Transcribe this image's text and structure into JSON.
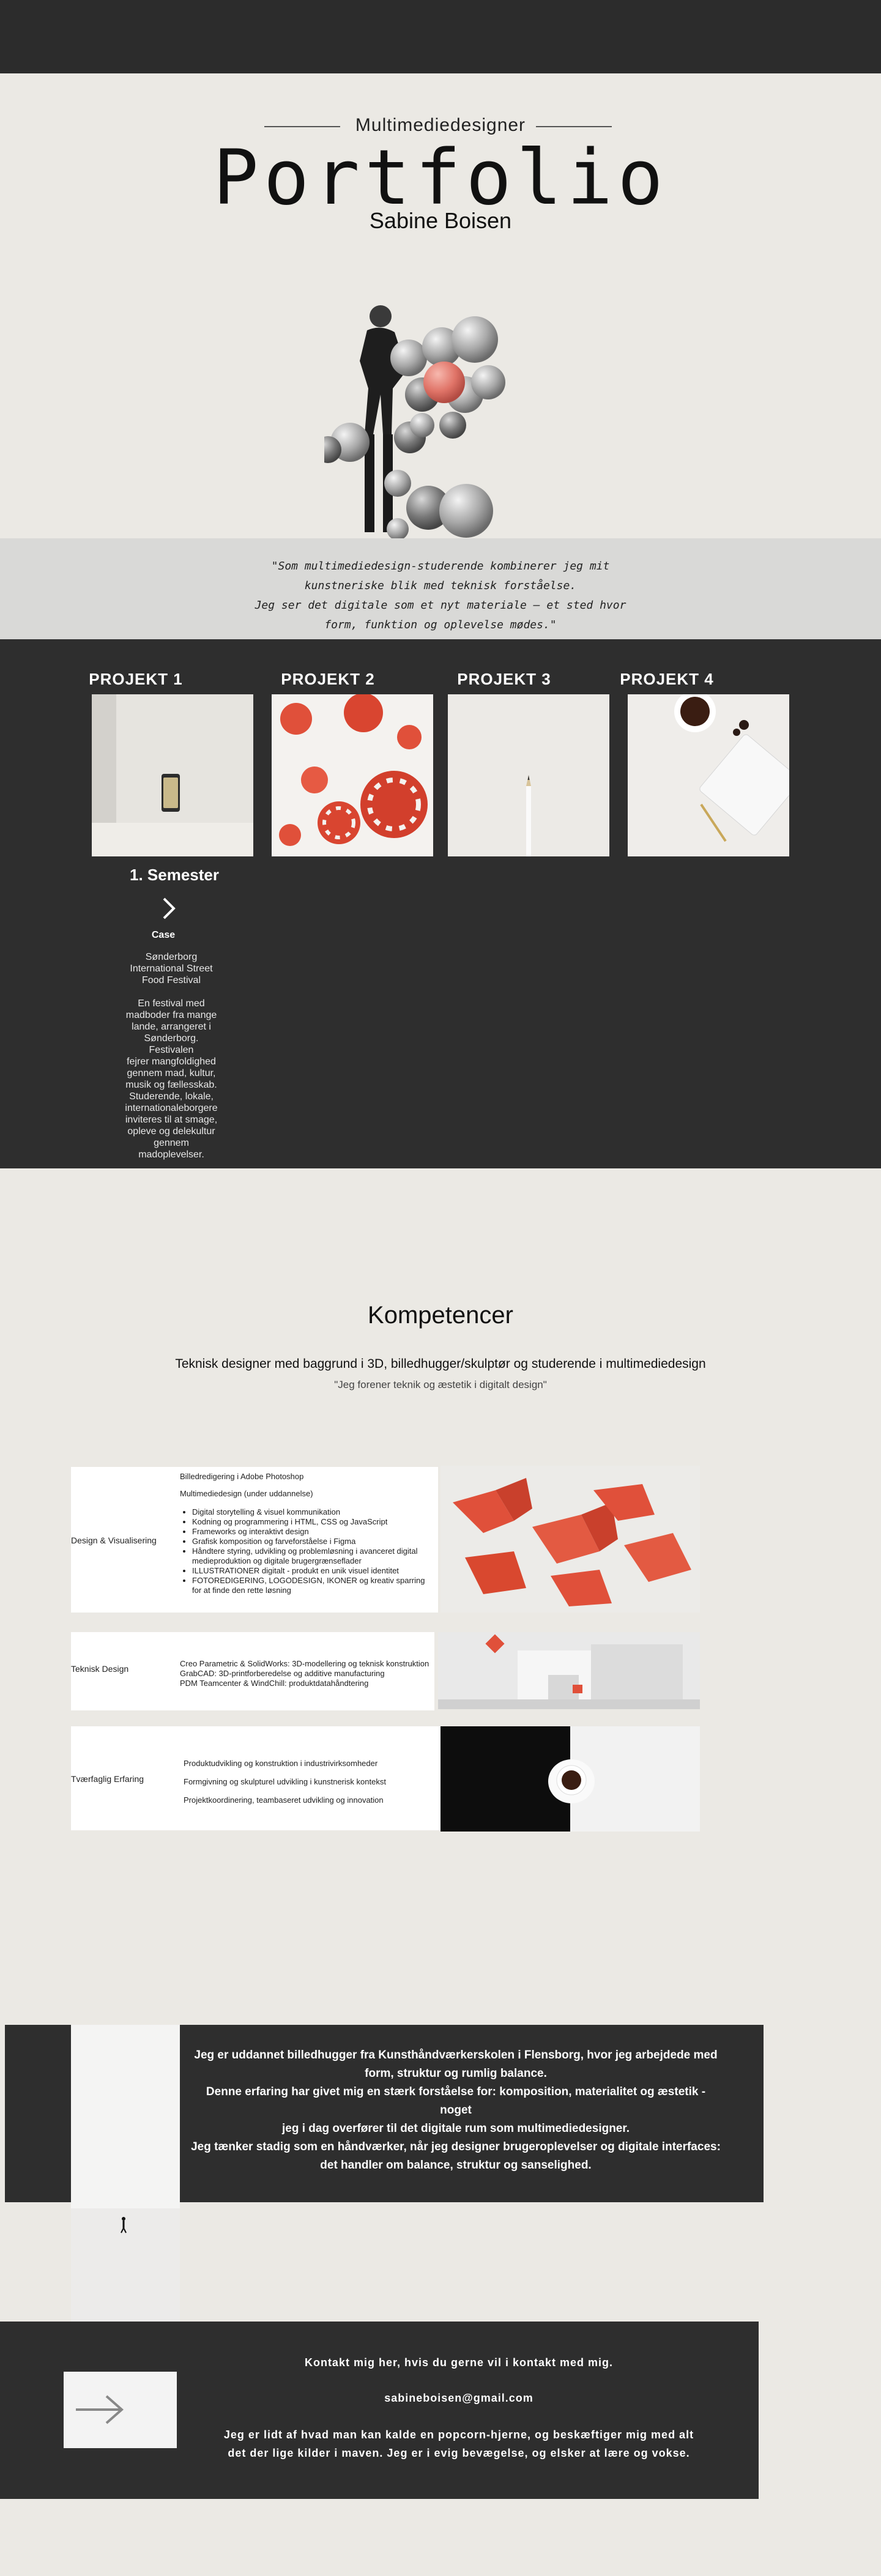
{
  "hero": {
    "subtitle": "Multimediedesigner",
    "title": "Portfolio",
    "name": "Sabine Boisen"
  },
  "quote": {
    "lines": [
      "\"Som multimediedesign-studerende kombinerer jeg mit",
      "kunstneriske blik med teknisk forståelse.",
      "Jeg ser det digitale som et nyt materiale  — et sted hvor",
      "form, funktion og oplevelse mødes.\""
    ]
  },
  "projects": {
    "items": [
      {
        "label": "PROJEKT 1",
        "image": "phone-mockup"
      },
      {
        "label": "PROJEKT 2",
        "image": "red-spheres"
      },
      {
        "label": "PROJEKT 3",
        "image": "pencil"
      },
      {
        "label": "PROJEKT 4",
        "image": "desk-keyboard"
      }
    ],
    "semester": "1. Semester",
    "case_label": "Case",
    "case_lines": [
      "Sønderborg",
      "International  Street",
      "Food Festival",
      "",
      "En festival med",
      "madboder fra mange",
      "lande, arrangeret i",
      "Sønderborg. Festivalen",
      "fejrer  mangfoldighed",
      "gennem mad, kultur,",
      "musik og fællesskab.",
      "Studerende, lokale,",
      "internationaleborgere",
      "inviteres til at smage,",
      "opleve og delekultur",
      "gennem",
      "madoplevelser."
    ]
  },
  "competences": {
    "title": "Kompetencer",
    "subtitle": "Teknisk designer med baggrund i 3D, billedhugger/skulptør og studerende i multimediedesign",
    "quote": "\"Jeg forener teknik og æstetik i digitalt design\"",
    "cards": [
      {
        "label": "Design & Visualisering",
        "head1": "Billedredigering i Adobe Photoshop",
        "head2": "Multimediedesign (under uddannelse)",
        "bullets": [
          "Digital storytelling & visuel kommunikation",
          "Kodning og programmering i HTML, CSS og JavaScript",
          "Frameworks og interaktivt design",
          "Grafisk komposition og farveforståelse i Figma",
          "Håndtere styring, udvikling og problemløsning i avanceret digital medieproduktion og digitale brugergrænseflader",
          "ILLUSTRATIONER digitalt - produkt en unik visuel identitet",
          "FOTOREDIGERING, LOGODESIGN, IKONER og kreativ sparring for at finde den rette løsning"
        ]
      },
      {
        "label": "Teknisk Design",
        "lines": [
          "Creo Parametric & SolidWorks: 3D-modellering og teknisk konstruktion",
          "GrabCAD: 3D-printforberedelse og additive manufacturing",
          "PDM Teamcenter & WindChill: produktdatahåndtering"
        ]
      },
      {
        "label": "Tværfaglig Erfaring",
        "lines": [
          "Produktudvikling og konstruktion i industrivirksomheder",
          "Formgivning og skulpturel udvikling i kunstnerisk kontekst",
          "Projektkoordinering, teambaseret udvikling og innovation"
        ]
      }
    ]
  },
  "about": {
    "lines": [
      "Jeg er uddannet billedhugger fra Kunsthåndværkerskolen i Flensborg, hvor jeg arbejdede med",
      "form, struktur og rumlig balance.",
      "Denne erfaring har givet mig en stærk forståelse for: komposition, materialitet og æstetik - noget",
      "jeg i dag overfører til det digitale rum som multimediedesigner.",
      "Jeg tænker stadig som en håndværker, når jeg designer brugeroplevelser og digitale interfaces:",
      "det handler om balance, struktur og sanselighed."
    ]
  },
  "contact": {
    "heading": "Kontakt mig her, hvis du gerne vil i kontakt med mig.",
    "email": "sabineboisen@gmail.com",
    "lines": [
      "Jeg er lidt af hvad man kan kalde en popcorn-hjerne, og beskæftiger mig med alt",
      "det der lige kilder i maven. Jeg er i evig bevægelse, og elsker at lære og vokse."
    ]
  },
  "colors": {
    "dark": "#2e2e2e",
    "background": "#ebe9e4",
    "quote_band": "#d9d9d7",
    "accent_red": "#e0503a"
  }
}
